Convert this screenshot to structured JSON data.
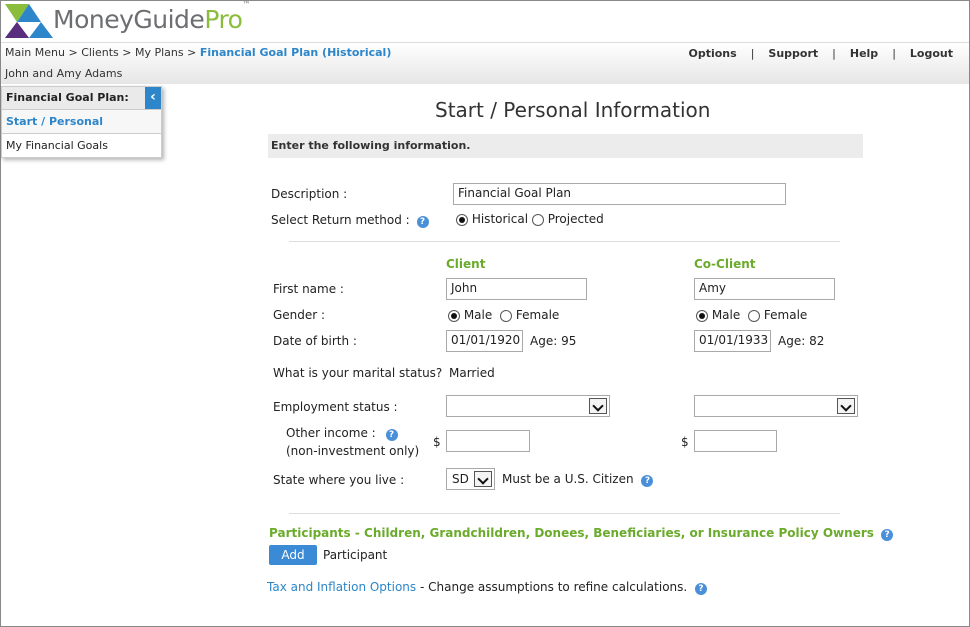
{
  "brand": {
    "money": "MoneyGuide",
    "pro": "Pro",
    "tm": "™"
  },
  "breadcrumb": {
    "main_menu": "Main Menu",
    "clients": "Clients",
    "my_plans": "My Plans",
    "current": "Financial Goal Plan (Historical)",
    "sep": ">"
  },
  "client_name": "John and Amy Adams",
  "topnav": {
    "options": "Options",
    "support": "Support",
    "help": "Help",
    "logout": "Logout",
    "sep": "|"
  },
  "sidebar": {
    "header": "Financial Goal Plan:",
    "items": [
      {
        "label": "Start / Personal"
      },
      {
        "label": "My Financial Goals"
      }
    ]
  },
  "page_title": "Start / Personal Information",
  "info_bar": "Enter the following information.",
  "form": {
    "description_label": "Description :",
    "description_value": "Financial Goal Plan",
    "return_method_label": "Select Return method :",
    "historical_label": "Historical",
    "projected_label": "Projected",
    "client_header": "Client",
    "coclient_header": "Co-Client",
    "first_name_label": "First name :",
    "client_first_name": "John",
    "coclient_first_name": "Amy",
    "gender_label": "Gender :",
    "male_label": "Male",
    "female_label": "Female",
    "dob_label": "Date of birth :",
    "client_dob": "01/01/1920",
    "coclient_dob": "01/01/1933",
    "age_label": "Age:",
    "client_age": "95",
    "coclient_age": "82",
    "marital_label": "What is your marital status?",
    "marital_value": "Married",
    "employment_label": "Employment status :",
    "other_income_label": "Other income :",
    "other_income_sub": "(non-investment only)",
    "dollar": "$",
    "state_label": "State where you live :",
    "state_value": "SD",
    "citizen_label": "Must be a U.S. Citizen"
  },
  "participants": {
    "header": "Participants - Children, Grandchildren, Donees, Beneficiaries, or Insurance Policy Owners",
    "add_label": "Add",
    "participant_label": "Participant"
  },
  "tax": {
    "link": "Tax and Inflation Options",
    "desc": " - Change assumptions to refine calculations."
  },
  "help_glyph": "?",
  "colors": {
    "accent": "#2c86c9",
    "green": "#6aab2c",
    "logo_gray": "#6d6e71"
  }
}
